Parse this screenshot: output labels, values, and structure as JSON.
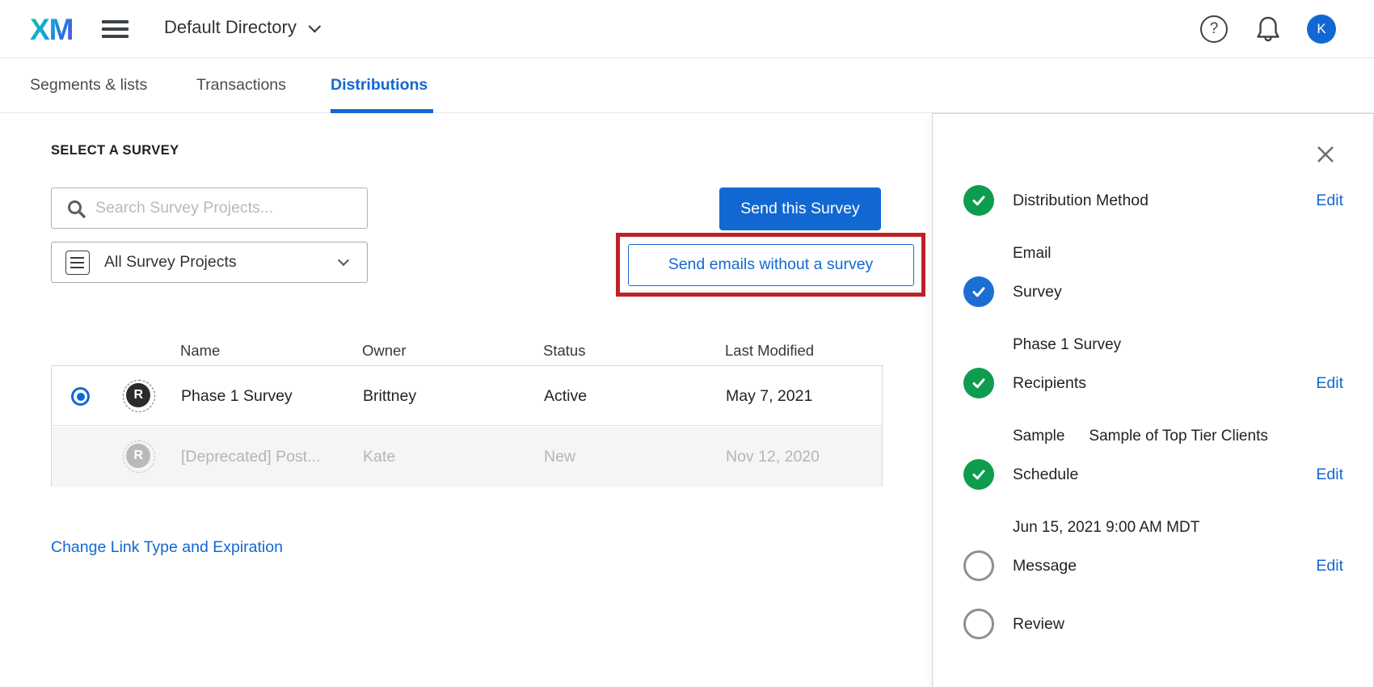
{
  "colors": {
    "accent_blue": "#1268d3",
    "complete_green": "#0e9c4f",
    "annotation_red": "#be2126",
    "disabled_gray": "#b5b5b5"
  },
  "topbar": {
    "logo": "XM",
    "directory_label": "Default Directory",
    "help_glyph": "?",
    "avatar_initial": "K"
  },
  "tabs": [
    {
      "label": "Segments & lists"
    },
    {
      "label": "Transactions"
    },
    {
      "label": "Distributions"
    }
  ],
  "main": {
    "heading": "SELECT A SURVEY",
    "search_placeholder": "Search Survey Projects...",
    "filter_label": "All Survey Projects",
    "send_button": "Send this Survey",
    "send_without_button": "Send emails without a survey",
    "change_link": "Change Link Type and Expiration",
    "table": {
      "headers": [
        "Name",
        "Owner",
        "Status",
        "Last Modified"
      ],
      "rows": [
        {
          "badge": "R",
          "name": "Phase 1 Survey",
          "owner": "Brittney",
          "status": "Active",
          "modified": "May 7, 2021",
          "selected": "true"
        },
        {
          "badge": "R",
          "name": "[Deprecated] Post...",
          "owner": "Kate",
          "status": "New",
          "modified": "Nov 12, 2020",
          "selected": "false"
        }
      ]
    }
  },
  "panel": {
    "steps": [
      {
        "label": "Distribution Method",
        "value": "Email",
        "state": "complete",
        "edit": "Edit"
      },
      {
        "label": "Survey",
        "value": "Phase 1 Survey",
        "state": "current"
      },
      {
        "label": "Recipients",
        "value": "Sample",
        "value2": "Sample of Top Tier Clients",
        "state": "complete",
        "edit": "Edit"
      },
      {
        "label": "Schedule",
        "value": "Jun 15, 2021 9:00 AM MDT",
        "state": "complete",
        "edit": "Edit"
      },
      {
        "label": "Message",
        "state": "pending",
        "edit": "Edit"
      },
      {
        "label": "Review",
        "state": "pending"
      }
    ]
  }
}
